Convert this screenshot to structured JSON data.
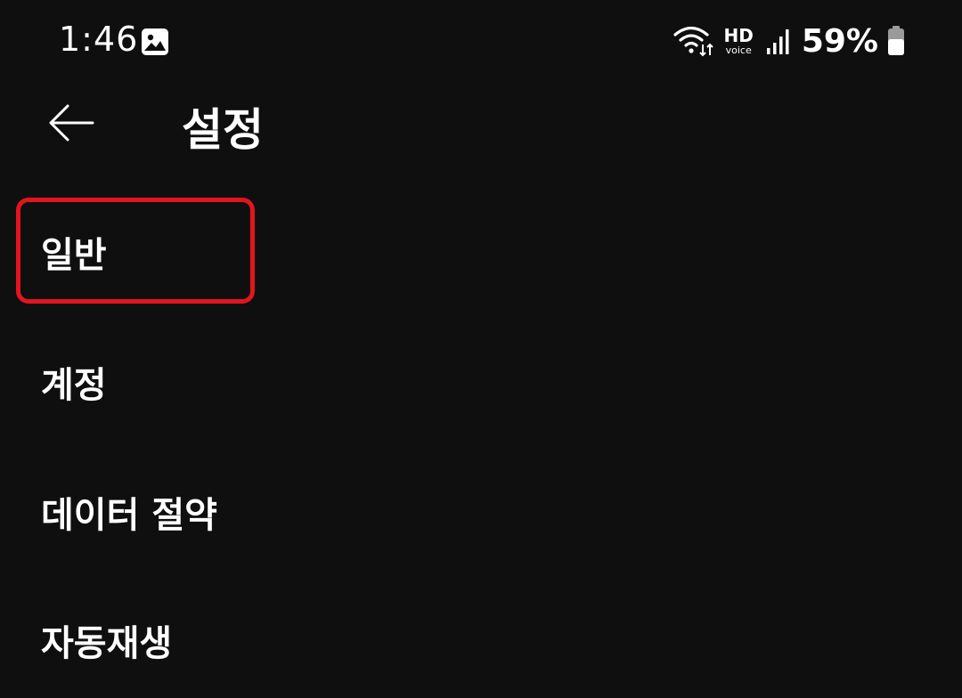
{
  "status_bar": {
    "time": "1:46",
    "notification_icon": "gallery-icon",
    "wifi_icon": "wifi-icon",
    "hd_label": "HD",
    "voice_label": "voice",
    "signal_icon": "signal-icon",
    "battery_percent": "59%",
    "battery_icon": "battery-icon"
  },
  "app_bar": {
    "back_icon": "back-arrow-icon",
    "title": "설정"
  },
  "settings": {
    "items": [
      {
        "label": "일반",
        "highlighted": true
      },
      {
        "label": "계정"
      },
      {
        "label": "데이터 절약"
      },
      {
        "label": "자동재생"
      }
    ]
  },
  "colors": {
    "background": "#0f0f0f",
    "text": "#ffffff",
    "highlight": "#e3141f"
  }
}
